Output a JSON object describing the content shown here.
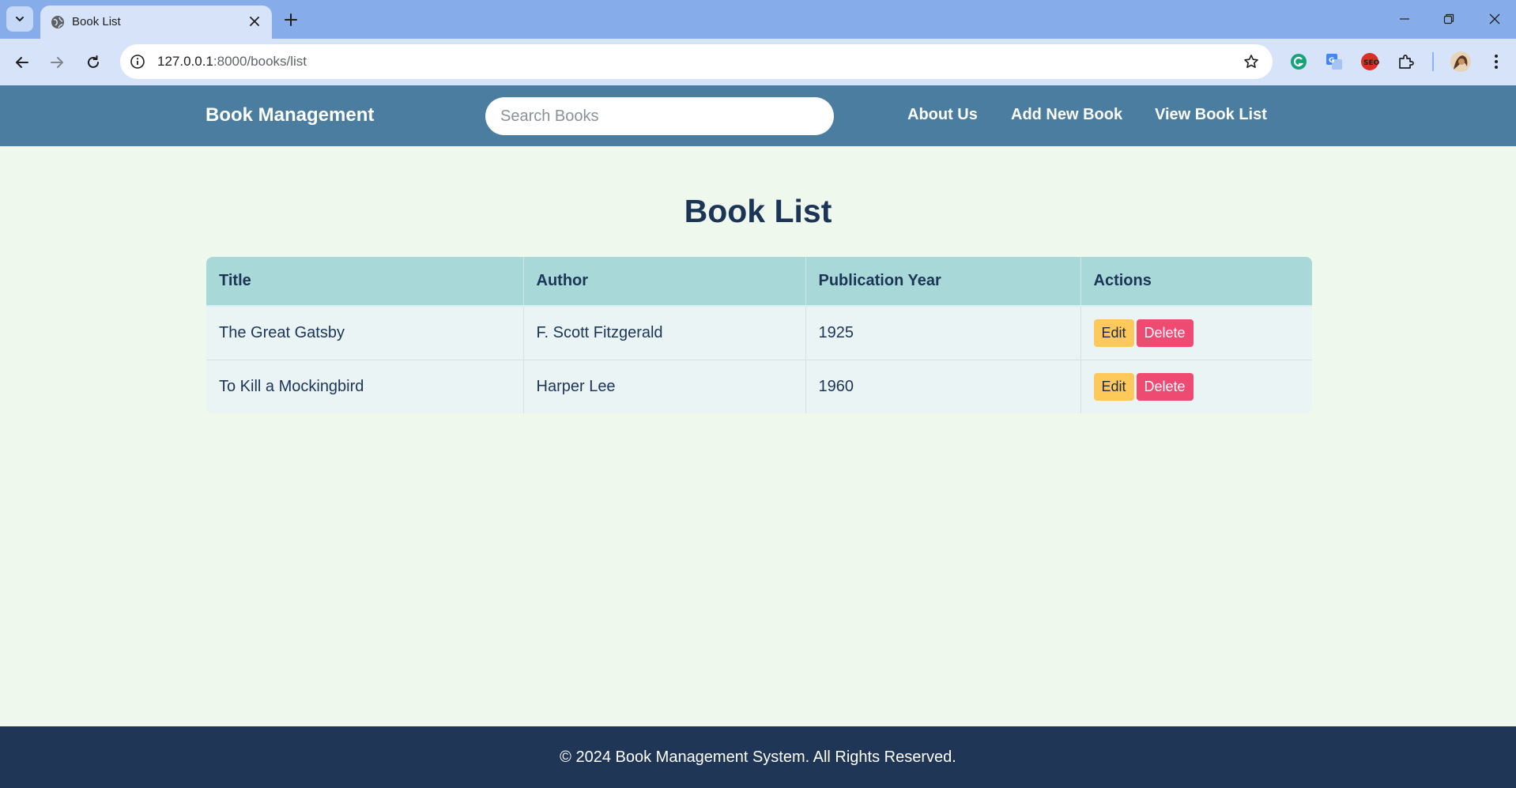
{
  "browser": {
    "tab_title": "Book List",
    "url_host": "127.0.0.1",
    "url_path": ":8000/books/list"
  },
  "header": {
    "brand": "Book Management",
    "search_placeholder": "Search Books",
    "nav": [
      "About Us",
      "Add New Book",
      "View Book List"
    ]
  },
  "main": {
    "title": "Book List",
    "columns": [
      "Title",
      "Author",
      "Publication Year",
      "Actions"
    ],
    "rows": [
      {
        "title": "The Great Gatsby",
        "author": "F. Scott Fitzgerald",
        "year": "1925"
      },
      {
        "title": "To Kill a Mockingbird",
        "author": "Harper Lee",
        "year": "1960"
      }
    ],
    "edit_label": "Edit",
    "delete_label": "Delete"
  },
  "footer": {
    "text": "© 2024 Book Management System. All Rights Reserved."
  },
  "colors": {
    "header_bg": "#4a7d9f",
    "page_bg": "#eef8ec",
    "table_header_bg": "#a8d8d8",
    "edit_bg": "#fdc95a",
    "delete_bg": "#ee4a72",
    "footer_bg": "#1f3656",
    "title_color": "#1c3557"
  },
  "icons": {
    "tab_menu": "chevron-down-icon",
    "favicon": "globe-icon",
    "tab_close": "close-icon",
    "new_tab": "plus-icon",
    "back": "arrow-left-icon",
    "forward": "arrow-right-icon",
    "reload": "reload-icon",
    "site_info": "info-icon",
    "bookmark": "star-icon",
    "extensions": [
      "grammarly-icon",
      "translate-icon",
      "seo-icon",
      "puzzle-icon"
    ],
    "profile": "avatar",
    "menu": "kebab-menu-icon"
  }
}
